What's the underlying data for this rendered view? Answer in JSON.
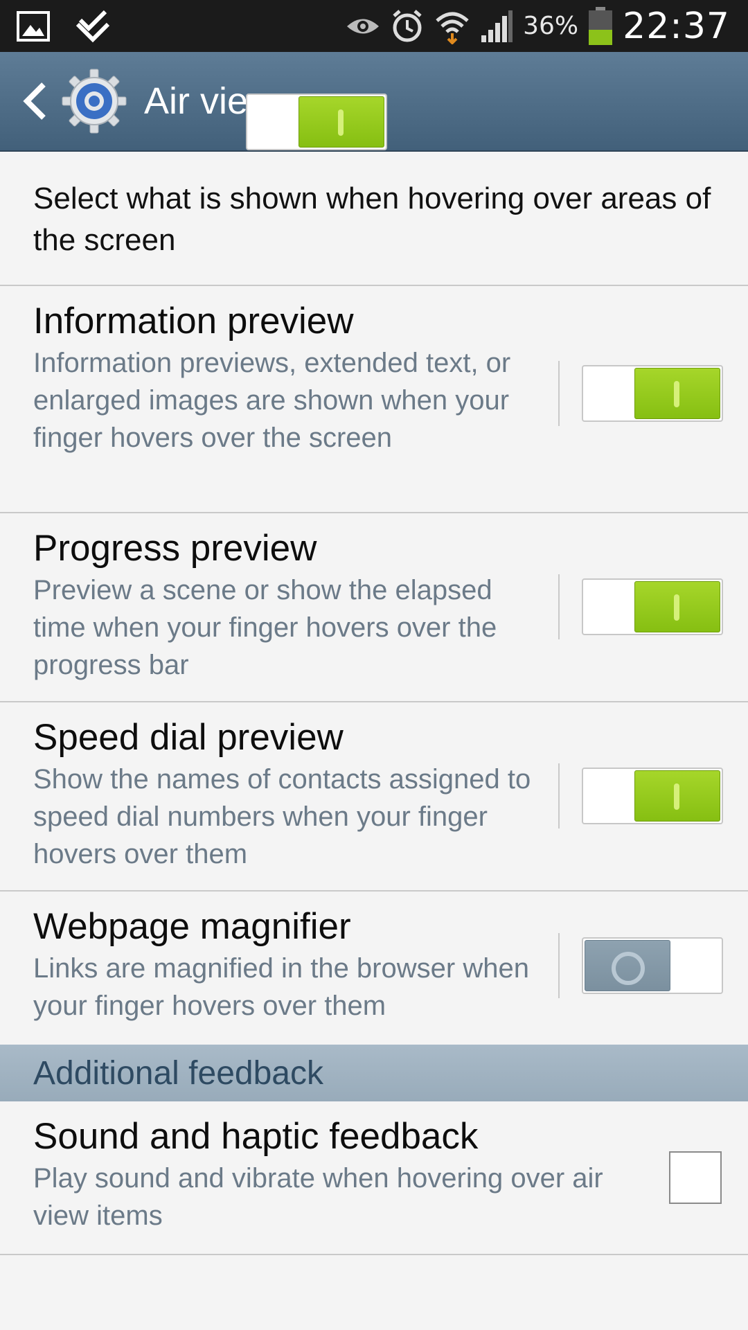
{
  "status_bar": {
    "battery_percent": "36%",
    "time": "22:37",
    "icons": [
      "gallery-icon",
      "tasks-icon",
      "eye-icon",
      "alarm-icon",
      "wifi-icon",
      "signal-icon",
      "battery-icon"
    ]
  },
  "action_bar": {
    "title": "Air view",
    "master_switch_on": true
  },
  "intro_text": "Select what is shown when hovering over areas of the screen",
  "settings": [
    {
      "title": "Information preview",
      "description": "Information previews, extended text, or enlarged images are shown when your finger hovers over the screen",
      "on": true
    },
    {
      "title": "Progress preview",
      "description": "Preview a scene or show the elapsed time when your finger hovers over the progress bar",
      "on": true
    },
    {
      "title": "Speed dial preview",
      "description": "Show the names of contacts assigned to speed dial numbers when your finger hovers over them",
      "on": true
    },
    {
      "title": "Webpage magnifier",
      "description": "Links are magnified in the browser when your finger hovers over them",
      "on": false
    }
  ],
  "section_header": "Additional feedback",
  "feedback": {
    "title": "Sound and haptic feedback",
    "description": "Play sound and vibrate when hovering over air view items",
    "checked": false
  },
  "colors": {
    "switch_on": "#94c91a",
    "switch_off": "#8499a8",
    "action_bar": "#4f6d87",
    "section_header": "#a2b4c3"
  }
}
